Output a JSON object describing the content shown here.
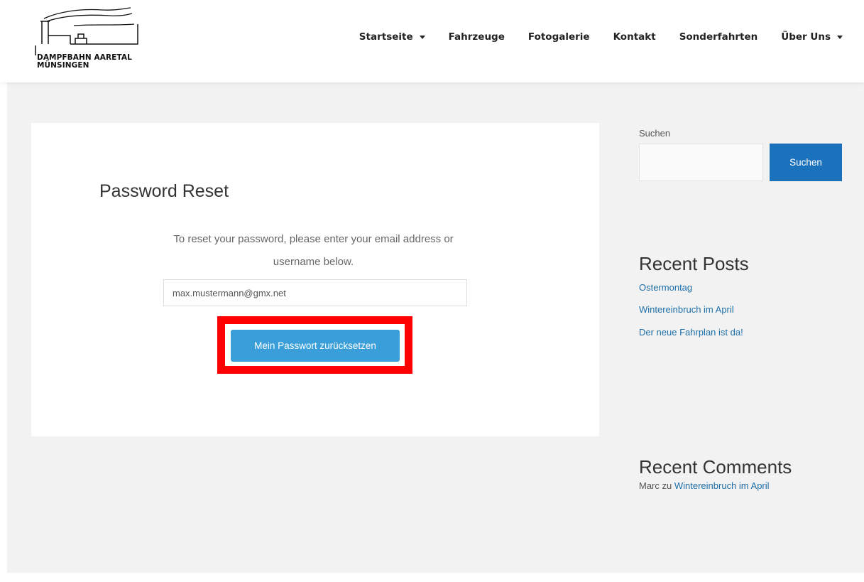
{
  "logo": {
    "line1": "DAMPFBAHN AARETAL",
    "line2": "MÜNSINGEN"
  },
  "nav": {
    "items": [
      {
        "label": "Startseite",
        "has_dropdown": true
      },
      {
        "label": "Fahrzeuge",
        "has_dropdown": false
      },
      {
        "label": "Fotogalerie",
        "has_dropdown": false
      },
      {
        "label": "Kontakt",
        "has_dropdown": false
      },
      {
        "label": "Sonderfahrten",
        "has_dropdown": false
      },
      {
        "label": "Über Uns",
        "has_dropdown": true
      }
    ]
  },
  "main": {
    "title": "Password Reset",
    "description": "To reset your password, please enter your email address or username below.",
    "email_value": "max.mustermann@gmx.net",
    "reset_button_label": "Mein Passwort zurücksetzen",
    "highlight_color": "#ff0000",
    "button_color": "#3a9fd9"
  },
  "sidebar": {
    "search_label": "Suchen",
    "search_value": "",
    "search_button_label": "Suchen",
    "search_button_color": "#1a72bd",
    "recent_posts_title": "Recent Posts",
    "recent_posts": [
      "Ostermontag",
      "Wintereinbruch im April",
      "Der neue Fahrplan ist da!"
    ],
    "recent_comments_title": "Recent Comments",
    "comment": {
      "author": "Marc",
      "connector": "zu",
      "post": "Wintereinbruch im April"
    },
    "link_color": "#1e6ea7"
  }
}
